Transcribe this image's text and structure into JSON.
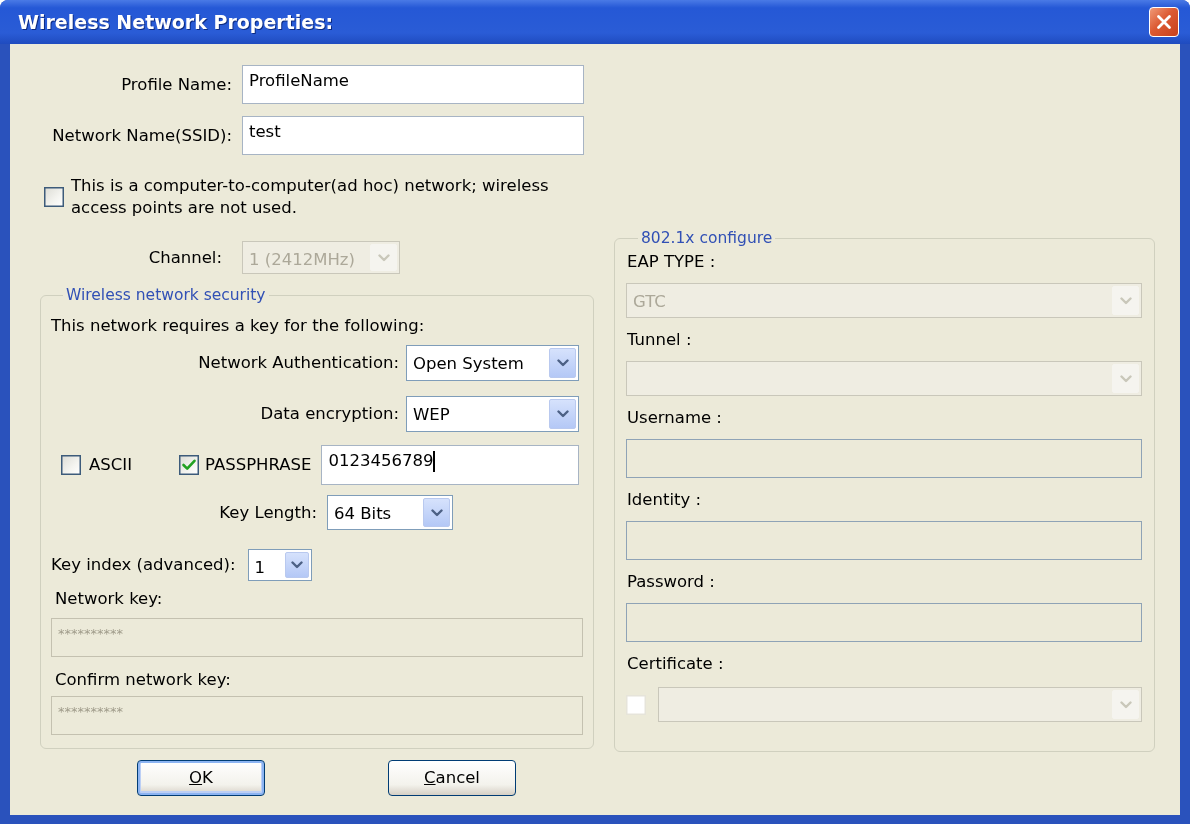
{
  "window": {
    "title": "Wireless Network Properties:"
  },
  "profile_name": {
    "label": "Profile Name:",
    "value": "ProfileName",
    "disabled": false
  },
  "network_name": {
    "label": "Network Name(SSID):",
    "value": "test",
    "disabled": false
  },
  "ad_hoc": {
    "label": "This is a computer-to-computer(ad hoc) network; wireless access points are not used.",
    "checked": false
  },
  "channel": {
    "label": "Channel:",
    "value": "1 (2412MHz)",
    "disabled": true
  },
  "security": {
    "legend": "Wireless network security",
    "intro": "This network requires a key for the following:",
    "network_authentication": {
      "label": "Network Authentication:",
      "value": "Open System",
      "disabled": false
    },
    "data_encryption": {
      "label": "Data encryption:",
      "value": "WEP",
      "disabled": false
    },
    "ascii": {
      "label": "ASCII",
      "checked": false
    },
    "passphrase": {
      "label": "PASSPHRASE",
      "checked": true
    },
    "passphrase_field": {
      "value": "0123456789",
      "focused": true
    },
    "key_length": {
      "label": "Key Length:",
      "value": "64 Bits",
      "disabled": false
    },
    "key_index": {
      "label": "Key index (advanced):",
      "value": "1",
      "disabled": false
    },
    "network_key": {
      "label": "Network key:",
      "value": "**********",
      "disabled": true
    },
    "confirm_network_key": {
      "label": "Confirm network key:",
      "value": "**********",
      "disabled": true
    }
  },
  "eap_config": {
    "legend": "802.1x configure",
    "fields": [
      {
        "kind": "dropdown",
        "label": "EAP TYPE :",
        "value": "GTC",
        "disabled": true
      },
      {
        "kind": "dropdown",
        "label": "Tunnel :",
        "disabled": true
      },
      {
        "kind": "text",
        "label": "Username :",
        "read_only": true
      },
      {
        "kind": "text",
        "label": "Identity :",
        "read_only": true
      },
      {
        "kind": "text",
        "label": "Password :",
        "read_only": true
      },
      {
        "kind": "checked_dropdown",
        "label": "Certificate :",
        "checked": false,
        "disabled": true
      }
    ]
  },
  "buttons": [
    {
      "label": "OK",
      "default": true,
      "access_key_underlined": true
    },
    {
      "label": "Cancel",
      "default": false,
      "access_key_underlined": true
    }
  ]
}
